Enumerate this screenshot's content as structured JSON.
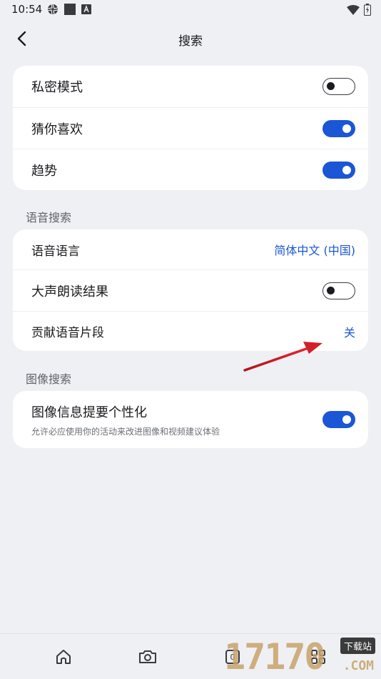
{
  "status_bar": {
    "time": "10:54",
    "left_icons": [
      "aperture-icon",
      "square-icon",
      "a-badge-icon"
    ],
    "right_icons": [
      "wifi-icon",
      "battery-icon"
    ]
  },
  "app_bar": {
    "title": "搜索",
    "back_icon": "back-arrow-icon"
  },
  "search_card": {
    "rows": [
      {
        "label": "私密模式",
        "toggle": "off"
      },
      {
        "label": "猜你喜欢",
        "toggle": "on"
      },
      {
        "label": "趋势",
        "toggle": "on"
      }
    ]
  },
  "voice_section": {
    "header": "语音搜索",
    "rows": [
      {
        "label": "语音语言",
        "value": "简体中文 (中国)"
      },
      {
        "label": "大声朗读结果",
        "toggle": "off"
      },
      {
        "label": "贡献语音片段",
        "value": "关"
      }
    ]
  },
  "image_section": {
    "header": "图像搜索",
    "row": {
      "label": "图像信息提要个性化",
      "sub": "允许必应使用你的活动来改进图像和视频建议体验",
      "toggle": "on"
    }
  },
  "bottom_nav": {
    "items": [
      "home-icon",
      "camera-icon",
      "tabs-icon",
      "apps-icon"
    ],
    "tab_count": "0"
  },
  "watermark": {
    "digits": "17170",
    "badge": "下载站",
    "suffix": ".COM"
  },
  "colors": {
    "accent": "#1a56d6",
    "background": "#eef0f4",
    "card": "#ffffff",
    "annotation_arrow": "#d0202a"
  }
}
